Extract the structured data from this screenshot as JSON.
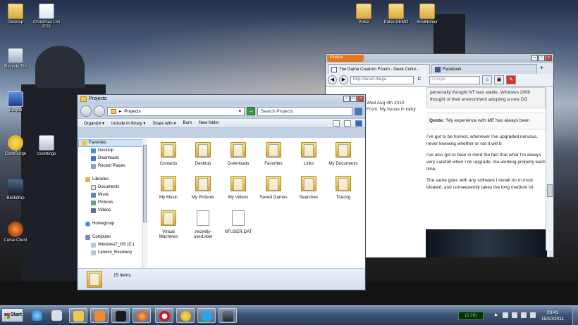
{
  "desktop": {
    "icons": [
      {
        "label": "Desktop",
        "icon": "folder-icon"
      },
      {
        "label": "Christmas List 2011",
        "icon": "word-doc-icon"
      },
      {
        "label": "Recycle Bin",
        "icon": "recycle-bin-icon"
      },
      {
        "label": "Dexpot",
        "icon": "dexpot-icon"
      },
      {
        "label": "CodeSurge",
        "icon": "codesurge-icon"
      },
      {
        "label": "cssettings",
        "icon": "settings-icon"
      },
      {
        "label": "Backdrop",
        "icon": "backdrop-icon"
      },
      {
        "label": "Curse Client",
        "icon": "curse-client-icon"
      },
      {
        "label": "Pulse",
        "icon": "folder-icon"
      },
      {
        "label": "Pulse DEMO",
        "icon": "folder-icon"
      },
      {
        "label": "SoulHunter",
        "icon": "folder-icon"
      }
    ]
  },
  "browser": {
    "menu_button": "Firefox",
    "tabs": [
      {
        "label": "The Game Creators Forum - Geek Cultur...",
        "icon": "page-icon"
      },
      {
        "label": "Facebook",
        "icon": "facebook-icon"
      }
    ],
    "url": "http://forum.thega",
    "search_placeholder": "Google",
    "post_meta": [
      "Wed Aug 4th 2010",
      "From: My house in rainy"
    ],
    "quote_box_text": "personally thought NT was stable, Windows 2000 thought of their environment adopting a new OS",
    "quote_line_label": "Quote:",
    "quote_line_text": "\"My experience with ME has always been",
    "paragraphs": [
      "I've got to be honest, whenever I've upgraded nervous, never knowing whether or not it will b",
      "I've also got to bear in mind the fact that what I'm always very carefull when I do upgrade, ma working properly each time.",
      "The same goes with any software I install on m most bloated, and consequently takes the long medium lol."
    ]
  },
  "explorer": {
    "title": "Projects",
    "address": "Projects",
    "search_placeholder": "Search Projects",
    "commands": [
      "Organize",
      "Include in library",
      "Share with",
      "Burn",
      "New folder"
    ],
    "nav": {
      "favorites": "Favorites",
      "favorite_items": [
        "Desktop",
        "Downloads",
        "Recent Places"
      ],
      "libraries": "Libraries",
      "library_items": [
        "Documents",
        "Music",
        "Pictures",
        "Videos"
      ],
      "homegroup": "Homegroup",
      "computer": "Computer",
      "computer_items": [
        "Windows7_OS (C:)",
        "Lenovo_Recovery"
      ]
    },
    "items": [
      {
        "label": "Contacts",
        "icon": "contacts-folder-icon"
      },
      {
        "label": "Desktop",
        "icon": "desktop-folder-icon"
      },
      {
        "label": "Downloads",
        "icon": "downloads-folder-icon"
      },
      {
        "label": "Favorites",
        "icon": "favorites-folder-icon"
      },
      {
        "label": "Links",
        "icon": "links-folder-icon"
      },
      {
        "label": "My Documents",
        "icon": "documents-folder-icon"
      },
      {
        "label": "My Music",
        "icon": "music-folder-icon"
      },
      {
        "label": "My Pictures",
        "icon": "pictures-folder-icon"
      },
      {
        "label": "My Videos",
        "icon": "videos-folder-icon"
      },
      {
        "label": "Saved Games",
        "icon": "saved-games-folder-icon"
      },
      {
        "label": "Searches",
        "icon": "searches-folder-icon"
      },
      {
        "label": "Tracing",
        "icon": "folder-icon"
      },
      {
        "label": "Virtual Machines",
        "icon": "folder-icon"
      },
      {
        "label": ".recently-used.xbel",
        "icon": "file-icon"
      },
      {
        "label": "NTUSER.DAT",
        "icon": "file-icon"
      }
    ],
    "status": "15 items"
  },
  "taskbar": {
    "start": "Start",
    "timer": "(2:28)",
    "time": "23:41",
    "date": "15/10/2011",
    "apps": [
      "internet-explorer-icon",
      "media-app-icon",
      "windows-explorer-icon",
      "media-player-icon",
      "pen-tool-icon",
      "firefox-icon",
      "opera-icon",
      "codesurge-icon",
      "skype-icon",
      "game-icon"
    ]
  }
}
